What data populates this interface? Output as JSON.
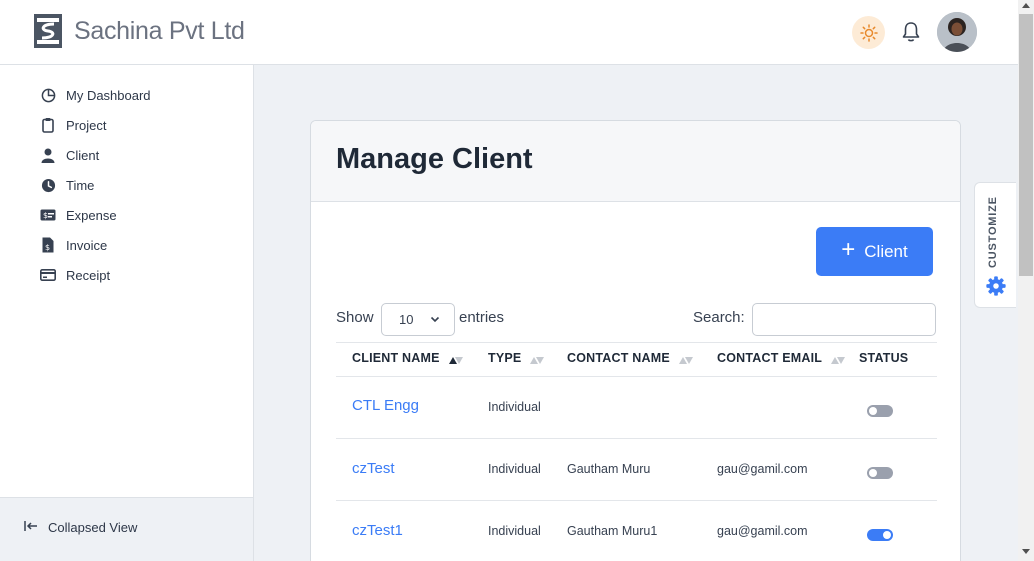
{
  "header": {
    "brand": "Sachina Pvt Ltd"
  },
  "sidebar": {
    "items": [
      {
        "label": "My Dashboard",
        "icon": "pie-chart-icon"
      },
      {
        "label": "Project",
        "icon": "clipboard-icon"
      },
      {
        "label": "Client",
        "icon": "user-icon"
      },
      {
        "label": "Time",
        "icon": "clock-icon"
      },
      {
        "label": "Expense",
        "icon": "money-icon"
      },
      {
        "label": "Invoice",
        "icon": "invoice-icon"
      },
      {
        "label": "Receipt",
        "icon": "card-icon"
      }
    ],
    "collapse_label": "Collapsed View"
  },
  "page": {
    "title": "Manage Client",
    "add_label": "Client",
    "show_label": "Show",
    "entries_value": "10",
    "entries_label": "entries",
    "search_label": "Search:",
    "search_value": ""
  },
  "table": {
    "headers": [
      "CLIENT NAME",
      "TYPE",
      "CONTACT NAME",
      "CONTACT EMAIL",
      "STATUS"
    ],
    "rows": [
      {
        "name": "CTL Engg",
        "type": "Individual",
        "contact": "",
        "email": "",
        "active": false
      },
      {
        "name": "czTest",
        "type": "Individual",
        "contact": "Gautham Muru",
        "email": "gau@gamil.com",
        "active": false
      },
      {
        "name": "czTest1",
        "type": "Individual",
        "contact": "Gautham Muru1",
        "email": "gau@gamil.com",
        "active": true
      }
    ]
  },
  "customize": {
    "label": "CUSTOMIZE"
  },
  "colors": {
    "accent": "#3b7cf6",
    "toggle_off": "#9aa0ad",
    "sun_bg": "#fdebd6"
  }
}
